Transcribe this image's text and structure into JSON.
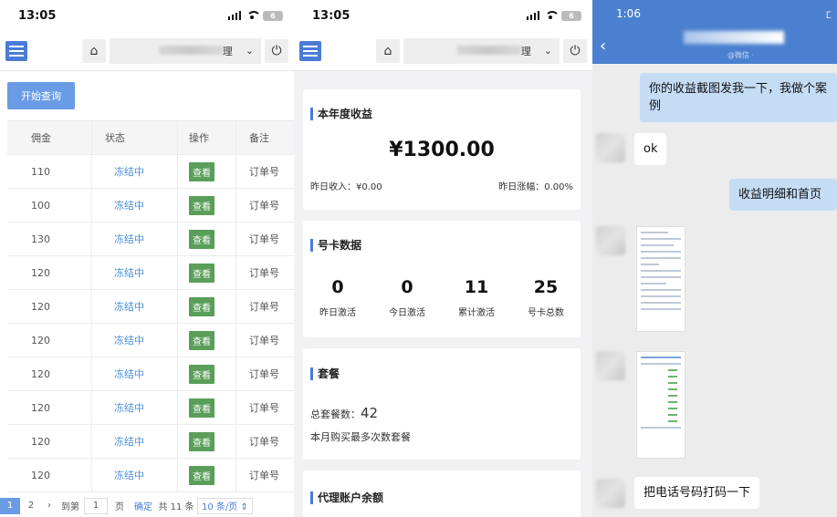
{
  "panel1": {
    "status_time": "13:05",
    "battery": "6",
    "select_suffix": "理",
    "query_button": "开始查询",
    "columns": [
      "佣金",
      "状态",
      "操作",
      "备注"
    ],
    "rows": [
      {
        "amount": "110",
        "status": "冻结中",
        "action": "查看",
        "note": "订单号"
      },
      {
        "amount": "100",
        "status": "冻结中",
        "action": "查看",
        "note": "订单号"
      },
      {
        "amount": "130",
        "status": "冻结中",
        "action": "查看",
        "note": "订单号"
      },
      {
        "amount": "120",
        "status": "冻结中",
        "action": "查看",
        "note": "订单号"
      },
      {
        "amount": "120",
        "status": "冻结中",
        "action": "查看",
        "note": "订单号"
      },
      {
        "amount": "120",
        "status": "冻结中",
        "action": "查看",
        "note": "订单号"
      },
      {
        "amount": "120",
        "status": "冻结中",
        "action": "查看",
        "note": "订单号"
      },
      {
        "amount": "120",
        "status": "冻结中",
        "action": "查看",
        "note": "订单号"
      },
      {
        "amount": "120",
        "status": "冻结中",
        "action": "查看",
        "note": "订单号"
      },
      {
        "amount": "120",
        "status": "冻结中",
        "action": "查看",
        "note": "订单号"
      }
    ],
    "pager": {
      "page1": "1",
      "page2": "2",
      "next": "›",
      "goto": "到第",
      "page_input": "1",
      "page_unit": "页",
      "confirm": "确定",
      "total": "共 11 条",
      "size": "10 条/页 ⇕"
    }
  },
  "panel2": {
    "status_time": "13:05",
    "battery": "6",
    "select_suffix": "理",
    "income": {
      "title": "本年度收益",
      "amount": "¥1300.00",
      "yesterday": "昨日收入：¥0.00",
      "growth": "昨日涨幅：0.00%"
    },
    "cards": {
      "title": "号卡数据",
      "stats": [
        {
          "value": "0",
          "label": "昨日激活"
        },
        {
          "value": "0",
          "label": "今日激活"
        },
        {
          "value": "11",
          "label": "累计激活"
        },
        {
          "value": "25",
          "label": "号卡总数"
        }
      ]
    },
    "package": {
      "title": "套餐",
      "total_label": "总套餐数：",
      "total_value": "42",
      "note": "本月购买最多次数套餐"
    },
    "balance": {
      "title": "代理账户余额"
    }
  },
  "panel3": {
    "status_time": "1:06",
    "sub": "@微信 ·",
    "messages": [
      {
        "side": "right",
        "text": "你的收益截图发我一下，我做个案例"
      },
      {
        "side": "left",
        "text": "ok"
      },
      {
        "side": "right",
        "text": "收益明细和首页"
      },
      {
        "side": "left",
        "text": "把电话号码打码一下"
      }
    ]
  },
  "colors": {
    "accent": "#4a7cd6",
    "view_button": "#5a9e5a",
    "status_text": "#4a90d9",
    "chat_header": "#4a80cf"
  }
}
